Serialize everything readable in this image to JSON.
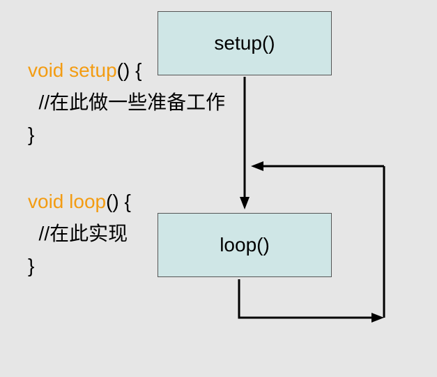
{
  "code": {
    "setup_keyword": "void setup",
    "setup_rest": "() {",
    "setup_comment": "  //在此做一些准备工作",
    "setup_close": "}",
    "loop_keyword": "void loop",
    "loop_rest": "() {",
    "loop_comment": "  //在此实现",
    "loop_close": "}"
  },
  "diagram": {
    "setup_box_label": "setup()",
    "loop_box_label": "loop()"
  },
  "colors": {
    "background": "#e6e6e6",
    "box_fill": "#cfe6e6",
    "keyword": "#f39c12",
    "arrow": "#000000"
  }
}
